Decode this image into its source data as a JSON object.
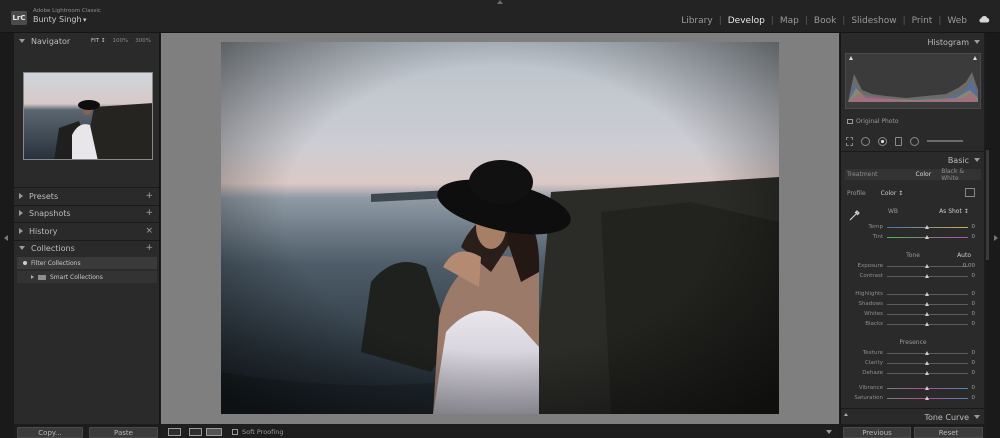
{
  "app": {
    "logo": "LrC",
    "name": "Adobe Lightroom Classic",
    "user": "Bunty Singh",
    "user_caret": "▾"
  },
  "modules": [
    "Library",
    "Develop",
    "Map",
    "Book",
    "Slideshow",
    "Print",
    "Web"
  ],
  "active_module": "Develop",
  "left_panel": {
    "navigator": {
      "title": "Navigator",
      "zoom": [
        "FIT ↕",
        "100%",
        "300%"
      ]
    },
    "presets": {
      "title": "Presets",
      "action": "+"
    },
    "snapshots": {
      "title": "Snapshots",
      "action": "+"
    },
    "history": {
      "title": "History",
      "action": "×"
    },
    "collections": {
      "title": "Collections",
      "action": "+",
      "filter": "Filter Collections",
      "smart": "Smart Collections"
    },
    "copy": "Copy...",
    "paste": "Paste"
  },
  "toolbar": {
    "soft_proofing": "Soft Proofing",
    "view_xy": "Y|Y"
  },
  "right_panel": {
    "histogram": {
      "title": "Histogram",
      "original_photo": "Original Photo"
    },
    "basic": {
      "title": "Basic",
      "treatment": "Treatment",
      "color": "Color",
      "bw": "Black & White",
      "profile_label": "Profile",
      "profile_value": "Color ↕",
      "wb_label": "WB",
      "wb_value": "As Shot ↕",
      "tone_label": "Tone",
      "auto": "Auto",
      "presence_label": "Presence"
    },
    "sliders_wb": [
      {
        "label": "Temp",
        "value": "0",
        "pos": 0.5
      },
      {
        "label": "Tint",
        "value": "0",
        "pos": 0.5
      }
    ],
    "sliders_tone_a": [
      {
        "label": "Exposure",
        "value": "0.00",
        "pos": 0.5
      },
      {
        "label": "Contrast",
        "value": "0",
        "pos": 0.5
      }
    ],
    "sliders_tone_b": [
      {
        "label": "Highlights",
        "value": "0",
        "pos": 0.5
      },
      {
        "label": "Shadows",
        "value": "0",
        "pos": 0.5
      },
      {
        "label": "Whites",
        "value": "0",
        "pos": 0.5
      },
      {
        "label": "Blacks",
        "value": "0",
        "pos": 0.5
      }
    ],
    "sliders_presence_a": [
      {
        "label": "Texture",
        "value": "0",
        "pos": 0.5
      },
      {
        "label": "Clarity",
        "value": "0",
        "pos": 0.5
      },
      {
        "label": "Dehaze",
        "value": "0",
        "pos": 0.5
      }
    ],
    "sliders_presence_b": [
      {
        "label": "Vibrance",
        "value": "0",
        "pos": 0.5
      },
      {
        "label": "Saturation",
        "value": "0",
        "pos": 0.5
      }
    ],
    "tone_curve": "Tone Curve",
    "previous": "Previous",
    "reset": "Reset"
  },
  "colors": {
    "accent": "#e6e6e6",
    "panel": "#2a2a2a",
    "background": "#7f7f7f"
  }
}
